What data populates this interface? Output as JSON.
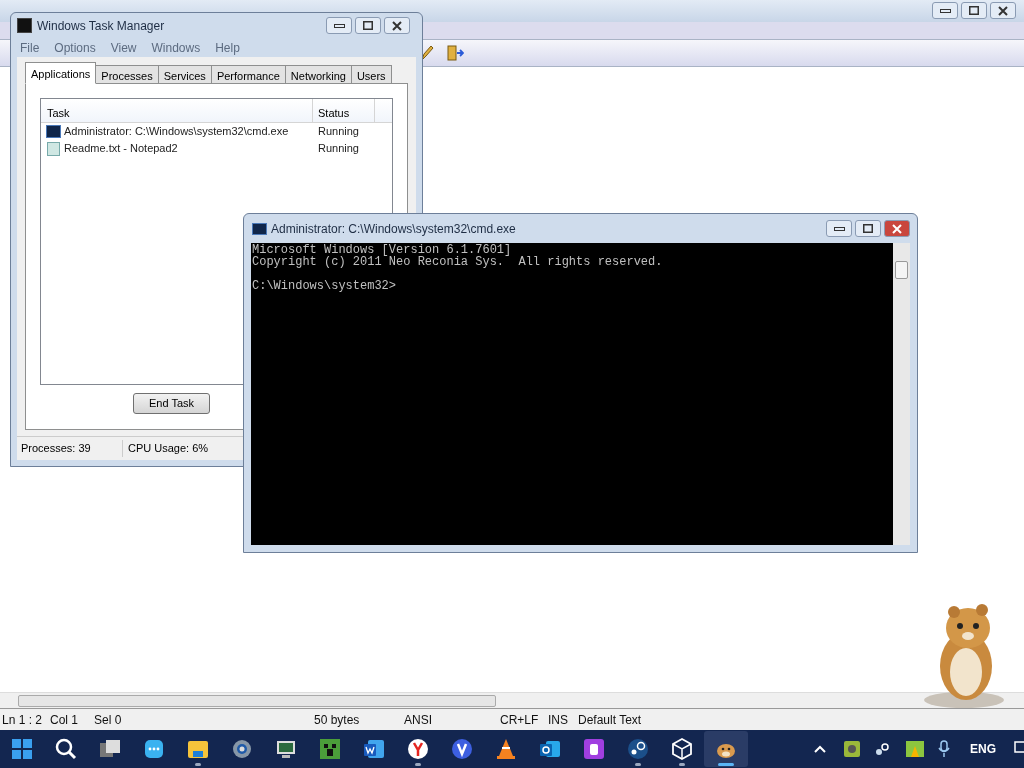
{
  "notepad": {
    "status_bar": [
      "Ln 1 : 2",
      "Col 1",
      "Sel 0",
      "50 bytes",
      "ANSI",
      "CR+LF",
      "INS",
      "Default Text"
    ]
  },
  "task_manager": {
    "title": "Windows Task Manager",
    "menu": [
      "File",
      "Options",
      "View",
      "Windows",
      "Help"
    ],
    "tabs": [
      {
        "label": "Applications",
        "selected": true
      },
      {
        "label": "Processes",
        "selected": false
      },
      {
        "label": "Services",
        "selected": false
      },
      {
        "label": "Performance",
        "selected": false
      },
      {
        "label": "Networking",
        "selected": false
      },
      {
        "label": "Users",
        "selected": false
      }
    ],
    "columns": [
      "Task",
      "Status"
    ],
    "rows": [
      {
        "kind": "console",
        "task": "Administrator: C:\\Windows\\system32\\cmd.exe",
        "status": "Running"
      },
      {
        "kind": "notepad",
        "task": "Readme.txt - Notepad2",
        "status": "Running"
      }
    ],
    "button": "End Task",
    "status_bar": [
      "Processes: 39",
      "CPU Usage: 6%"
    ]
  },
  "console": {
    "title": "Administrator: C:\\Windows\\system32\\cmd.exe",
    "blocks": [
      [
        "Microsoft Windows [Version 6.1.7601]",
        "Copyright (c) 2011 Neo Reconia Sys.  All rights reserved."
      ],
      [
        "C:\\Windows\\system32>"
      ]
    ]
  },
  "taskbar": {
    "apps": [
      {
        "kind": "start",
        "running": false,
        "active": false
      },
      {
        "kind": "search",
        "running": false,
        "active": false
      },
      {
        "kind": "taskview",
        "running": false,
        "active": false
      },
      {
        "kind": "chat",
        "running": false,
        "active": false
      },
      {
        "kind": "folder",
        "running": true,
        "active": false
      },
      {
        "kind": "gear",
        "running": false,
        "active": false
      },
      {
        "kind": "monitor",
        "running": false,
        "active": false
      },
      {
        "kind": "creeper",
        "running": false,
        "active": false
      },
      {
        "kind": "word",
        "running": false,
        "active": false
      },
      {
        "kind": "y",
        "running": true,
        "active": false
      },
      {
        "kind": "v",
        "running": false,
        "active": false
      },
      {
        "kind": "cone",
        "running": false,
        "active": false
      },
      {
        "kind": "mail",
        "running": false,
        "active": false
      },
      {
        "kind": "cylinder",
        "running": false,
        "active": false
      },
      {
        "kind": "steam",
        "running": true,
        "active": false
      },
      {
        "kind": "cube",
        "running": true,
        "active": false
      },
      {
        "kind": "hamster",
        "running": true,
        "active": true
      }
    ],
    "language": "ENG"
  }
}
